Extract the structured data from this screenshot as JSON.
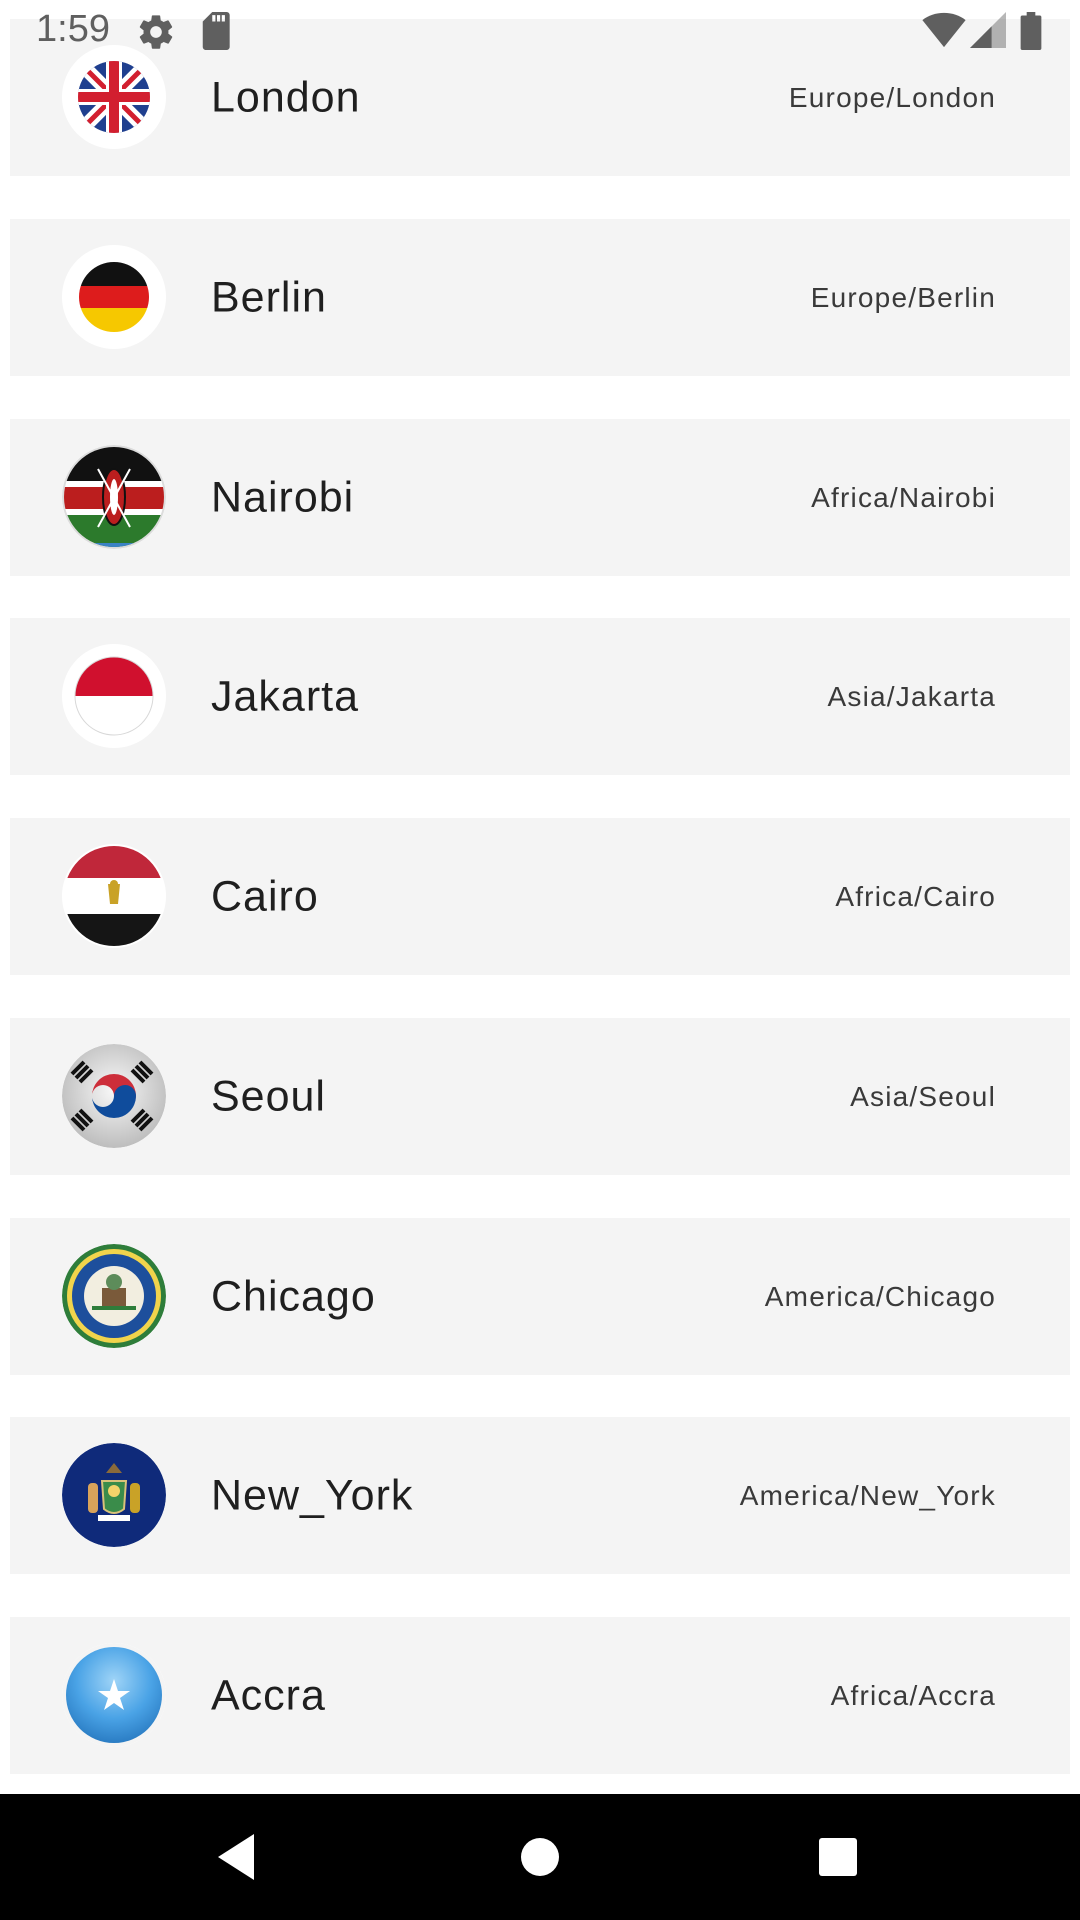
{
  "status_bar": {
    "time": "1:59",
    "icons": [
      "gear-icon",
      "sd-card-icon",
      "wifi-icon",
      "signal-icon",
      "battery-icon"
    ]
  },
  "cities": [
    {
      "name": "London",
      "timezone": "Europe/London",
      "flag": "uk-flag-icon"
    },
    {
      "name": "Berlin",
      "timezone": "Europe/Berlin",
      "flag": "germany-flag-icon"
    },
    {
      "name": "Nairobi",
      "timezone": "Africa/Nairobi",
      "flag": "kenya-flag-icon"
    },
    {
      "name": "Jakarta",
      "timezone": "Asia/Jakarta",
      "flag": "indonesia-flag-icon"
    },
    {
      "name": "Cairo",
      "timezone": "Africa/Cairo",
      "flag": "egypt-flag-icon"
    },
    {
      "name": "Seoul",
      "timezone": "Asia/Seoul",
      "flag": "south-korea-flag-icon"
    },
    {
      "name": "Chicago",
      "timezone": "America/Chicago",
      "flag": "chicago-seal-icon"
    },
    {
      "name": "New_York",
      "timezone": "America/New_York",
      "flag": "new-york-seal-icon"
    },
    {
      "name": "Accra",
      "timezone": "Africa/Accra",
      "flag": "star-flag-icon"
    }
  ],
  "nav_bar": {
    "icons": [
      "back-icon",
      "home-icon",
      "recents-icon"
    ]
  },
  "colors": {
    "card_background": "#f4f4f4",
    "nav_background": "#000000",
    "text_primary": "#1f1f1f",
    "text_secondary": "#3a3a3a"
  }
}
